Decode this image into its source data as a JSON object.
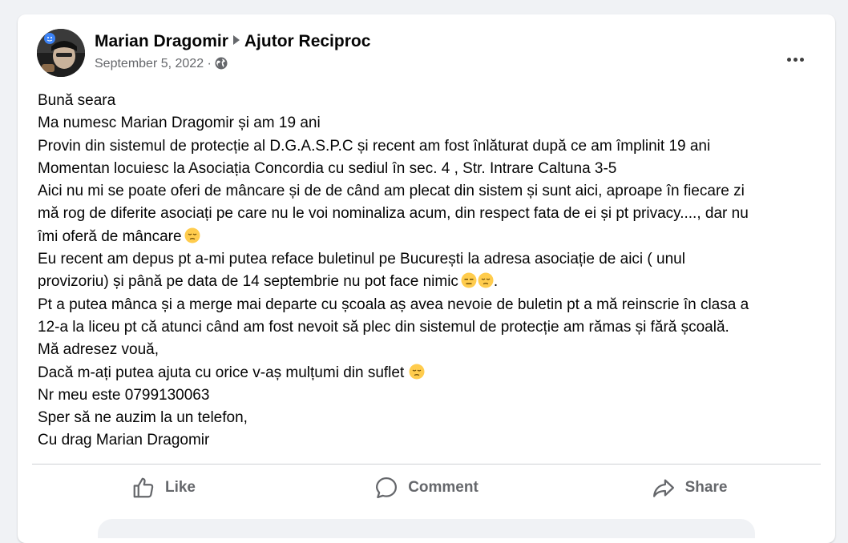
{
  "post": {
    "author": "Marian Dragomir",
    "group": "Ajutor Reciproc",
    "date": "September 5, 2022",
    "separator": "·",
    "privacy_icon": "globe-icon",
    "more_icon": "more-horizontal-icon",
    "lines": [
      "Bună seara",
      "Ma numesc Marian Dragomir și am 19 ani",
      "Provin din sistemul de protecție al D.G.A.S.P.C și recent am fost înlăturat după ce am împlinit 19 ani",
      "Momentan locuiesc la Asociația Concordia  cu sediul în sec. 4 , Str. Intrare Caltuna 3-5",
      "Aici nu mi se poate oferi de mâncare și de de când am plecat din sistem și sunt aici, aproape în fiecare zi",
      "mă rog de diferite asociați pe care nu le voi nominaliza acum, din respect fata de ei și pt privacy...., dar nu",
      "îmi oferă de mâncare",
      "Eu recent am depus pt a-mi putea reface buletinul pe București la adresa asociație de aici ( unul",
      "provizoriu) și până pe data de 14 septembrie nu pot face nimic",
      "Pt a putea mânca și a merge mai departe cu școala aș avea nevoie de buletin pt a mă reinscrie în clasa a",
      "12-a la liceu pt că atunci când am fost nevoit să plec din sistemul de protecție am rămas și fără școală.",
      "Mă adresez vouă,",
      "Dacă m-ați putea ajuta cu orice v-aș mulțumi din suflet",
      "Nr meu este 0799130063",
      "Sper să ne auzim la un telefon,",
      "Cu drag  Marian Dragomir"
    ],
    "line_suffix_9": "."
  },
  "actions": {
    "like_label": "Like",
    "comment_label": "Comment",
    "share_label": "Share"
  },
  "colors": {
    "text": "#050505",
    "secondary": "#65676b",
    "background": "#f0f2f5",
    "card": "#ffffff",
    "emoji": "#ffcc4d"
  }
}
